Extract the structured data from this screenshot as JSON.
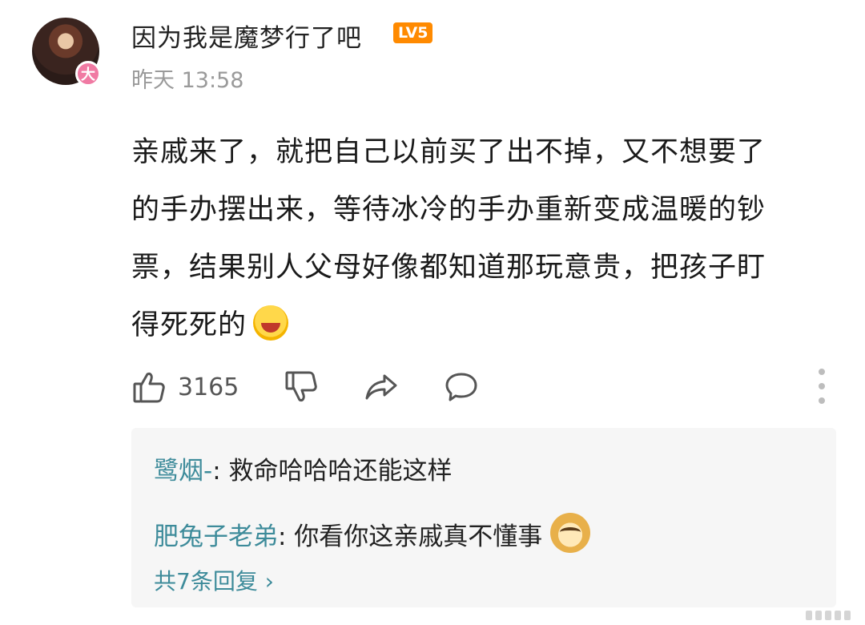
{
  "comment": {
    "username": "因为我是魔梦行了吧",
    "level_badge": "LV5",
    "avatar_badge": "大",
    "timestamp": "昨天 13:58",
    "body_lines": [
      "亲戚来了，就把自己以前买了出不掉，又不想要了",
      "的手办摆出来，等待冰冷的手办重新变成温暖的钞",
      "票，结果别人父母好像都知道那玩意贵，把孩子盯",
      "得死死的"
    ],
    "body_emoji": "laugh-cry-emoji"
  },
  "actions": {
    "like_count": "3165",
    "icons": [
      "thumbs-up-icon",
      "thumbs-down-icon",
      "share-icon",
      "comment-icon",
      "more-vertical-icon"
    ]
  },
  "replies": {
    "items": [
      {
        "name": "鹭烟-",
        "text": ": 救命哈哈哈还能这样"
      },
      {
        "name": "肥兔子老弟",
        "text": ": 你看你这亲戚真不懂事"
      }
    ],
    "second_reply_emoji": "doge-emoji",
    "more_label": "共7条回复 ›"
  },
  "colors": {
    "reply_name": "#3d8b9a",
    "level_badge": "#ff8a00",
    "timestamp": "#9a9a9a",
    "reply_background": "#f6f6f6"
  }
}
